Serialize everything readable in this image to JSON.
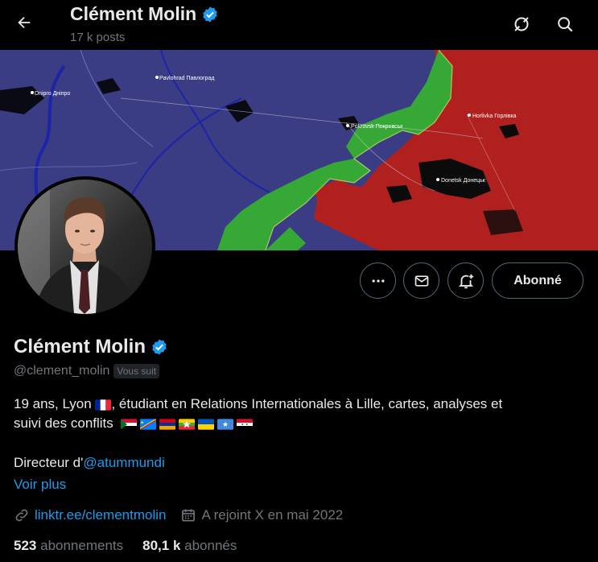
{
  "header": {
    "name": "Clément Molin",
    "posts_count": "17 k posts"
  },
  "banner": {
    "map_labels": [
      "Pavlohrad Павлоград",
      "Dnipro Дніпро",
      "Pokrovsk Покровськ",
      "Horlivka Горлівка",
      "Donetsk Донецьк"
    ],
    "colors": {
      "ukraine_controlled": "#3b3e86",
      "russian_controlled": "#b0201e",
      "contested": "#2e9a2e"
    }
  },
  "profile": {
    "name": "Clément Molin",
    "handle": "@clement_molin",
    "follows_you": "Vous suit",
    "bio_line1": "19 ans, Lyon",
    "bio_line1_rest": ", étudiant en Relations Internationales à Lille, cartes, analyses et",
    "bio_line2": "suivi des conflits",
    "director_prefix": "Directeur d'",
    "director_link": "@atummundi",
    "see_more": "Voir plus",
    "website": "linktr.ee/clementmolin",
    "joined": "A rejoint X en mai 2022"
  },
  "actions": {
    "follow_label": "Abonné"
  },
  "stats": {
    "following_count": "523",
    "following_label": "abonnements",
    "followers_count": "80,1 k",
    "followers_label": "abonnés"
  },
  "colors": {
    "accent": "#1d9bf0",
    "muted": "#71767b",
    "text": "#e7e9ea",
    "background": "#000000"
  }
}
